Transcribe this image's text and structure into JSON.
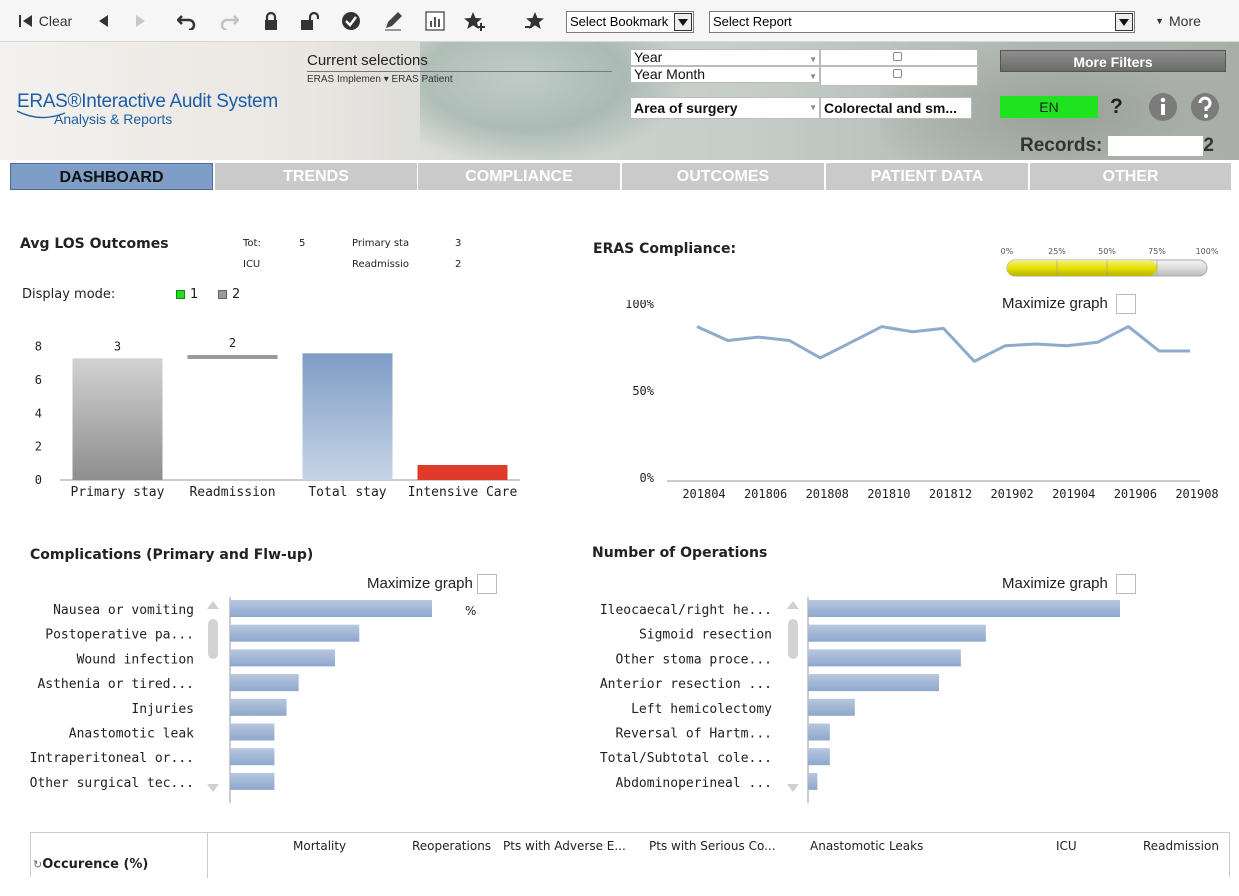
{
  "toolbar": {
    "clear_label": "Clear",
    "bookmark_select": "Select Bookmark",
    "report_select": "Select Report",
    "more_label": "More"
  },
  "header": {
    "logo_title": "ERAS®Interactive Audit System",
    "logo_sub": "Analysis & Reports",
    "current_selections_title": "Current selections",
    "current_selections_value": "ERAS Implemen   ▾ ERAS Patient",
    "filters": {
      "year": "Year",
      "year_month": "Year Month",
      "area_label": "Area of surgery",
      "area_value": "Colorectal and sm..."
    },
    "more_filters": "More Filters",
    "language": "EN",
    "help_q": "?",
    "records_label": "Records:",
    "records_value": "2"
  },
  "tabs": [
    "DASHBOARD",
    "TRENDS",
    "COMPLIANCE",
    "OUTCOMES",
    "PATIENT DATA",
    "OTHER"
  ],
  "los": {
    "title": "Avg LOS Outcomes",
    "summary": {
      "tot_label": "Tot:",
      "tot_value": "5",
      "icu_label": "ICU",
      "primary_label": "Primary sta",
      "primary_value": "3",
      "readm_label": "Readmissio",
      "readm_value": "2"
    },
    "display_mode_label": "Display mode:",
    "mode1": "1",
    "mode2": "2"
  },
  "compliance": {
    "title": "ERAS Compliance:",
    "gauge_ticks": [
      "0%",
      "25%",
      "50%",
      "75%",
      "100%"
    ],
    "gauge_level": 0.75,
    "maximize_label": "Maximize graph"
  },
  "complications": {
    "title": "Complications (Primary and Flw-up)",
    "maximize_label": "Maximize graph",
    "stray_label": "%"
  },
  "operations": {
    "title": "Number of Operations",
    "maximize_label": "Maximize graph"
  },
  "chart_data": [
    {
      "type": "bar",
      "categories": [
        "Primary stay",
        "Readmission",
        "Total stay",
        "Intensive Care"
      ],
      "values": [
        7.3,
        7.5,
        7.6,
        0.9
      ],
      "data_labels": [
        "3",
        "2",
        "",
        ""
      ],
      "ylim": [
        0,
        9
      ],
      "yticks": [
        0,
        2,
        4,
        6,
        8
      ],
      "colors": [
        "#a9a9a9",
        "#9a9a9a",
        "#8faad0",
        "#e03a2a"
      ]
    },
    {
      "type": "line",
      "x": [
        "201804",
        "201805",
        "201806",
        "201807",
        "201808",
        "201809",
        "201810",
        "201811",
        "201812",
        "201901",
        "201902",
        "201903",
        "201904",
        "201905",
        "201906",
        "201907",
        "201908"
      ],
      "xticks": [
        "201804",
        "201806",
        "201808",
        "201810",
        "201812",
        "201902",
        "201904",
        "201906",
        "201908"
      ],
      "values": [
        0.87,
        0.79,
        0.81,
        0.79,
        0.69,
        0.78,
        0.87,
        0.84,
        0.86,
        0.67,
        0.76,
        0.77,
        0.76,
        0.78,
        0.87,
        0.73,
        0.73
      ],
      "yticks": [
        "0%",
        "50%",
        "100%"
      ],
      "ylim": [
        0,
        1
      ],
      "color": "#8eaacd"
    },
    {
      "type": "bar",
      "orientation": "horizontal",
      "categories": [
        "Nausea or vomiting",
        "Postoperative pa...",
        "Wound infection",
        "Asthenia or tired...",
        "Injuries",
        "Anastomotic leak",
        "Intraperitoneal or...",
        "Other surgical tec..."
      ],
      "values": [
        1.0,
        0.64,
        0.52,
        0.34,
        0.28,
        0.22,
        0.22,
        0.22
      ],
      "color": "#9fb5d6"
    },
    {
      "type": "bar",
      "orientation": "horizontal",
      "categories": [
        "Ileocaecal/right he...",
        "Sigmoid resection",
        "Other stoma proce...",
        "Anterior resection ...",
        "Left hemicolectomy",
        "Reversal of Hartm...",
        "Total/Subtotal cole...",
        "Abdominoperineal ..."
      ],
      "values": [
        1.0,
        0.57,
        0.49,
        0.42,
        0.15,
        0.07,
        0.07,
        0.03
      ],
      "color": "#9fb5d6"
    }
  ],
  "occurence": {
    "title": "Occurence (%)",
    "columns": [
      "Mortality",
      "Reoperations",
      "Pts with Adverse E...",
      "Pts with Serious Co...",
      "Anastomotic Leaks",
      "ICU",
      "Readmission"
    ]
  }
}
